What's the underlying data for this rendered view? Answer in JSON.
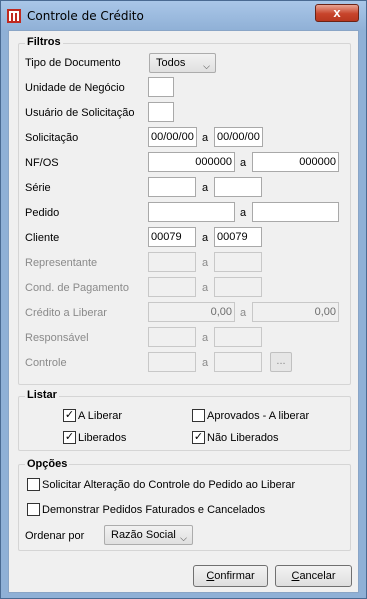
{
  "window": {
    "title": "Controle de Crédito",
    "close_glyph": "x"
  },
  "filtros": {
    "title": "Filtros",
    "tipo_documento": {
      "label": "Tipo de Documento",
      "value": "Todos"
    },
    "unidade_negocio": {
      "label": "Unidade de Negócio",
      "value": ""
    },
    "usuario_solicitacao": {
      "label": "Usuário de Solicitação",
      "value": ""
    },
    "solicitacao": {
      "label": "Solicitação",
      "from": "00/00/00",
      "sep": "a",
      "to": "00/00/00"
    },
    "nf_os": {
      "label": "NF/OS",
      "from": "000000",
      "sep": "a",
      "to": "000000"
    },
    "serie": {
      "label": "Série",
      "from": "",
      "sep": "a",
      "to": ""
    },
    "pedido": {
      "label": "Pedido",
      "from": "",
      "sep": "a",
      "to": ""
    },
    "cliente": {
      "label": "Cliente",
      "from": "00079",
      "sep": "a",
      "to": "00079"
    },
    "representante": {
      "label": "Representante",
      "from": "",
      "sep": "a",
      "to": ""
    },
    "cond_pagamento": {
      "label": "Cond. de Pagamento",
      "from": "",
      "sep": "a",
      "to": ""
    },
    "credito_liberar": {
      "label": "Crédito a Liberar",
      "from": "0,00",
      "sep": "a",
      "to": "0,00"
    },
    "responsavel": {
      "label": "Responsável",
      "from": "",
      "sep": "a",
      "to": ""
    },
    "controle": {
      "label": "Controle",
      "from": "",
      "sep": "a",
      "to": "",
      "button": "..."
    }
  },
  "listar": {
    "title": "Listar",
    "a_liberar": {
      "label": "A Liberar",
      "checked": true
    },
    "aprovados": {
      "label": "Aprovados - A liberar",
      "checked": false
    },
    "liberados": {
      "label": "Liberados",
      "checked": true
    },
    "nao_liberados": {
      "label": "Não Liberados",
      "checked": true
    }
  },
  "opcoes": {
    "title": "Opções",
    "solicitar_alteracao": {
      "label": "Solicitar Alteração do Controle do Pedido ao Liberar",
      "checked": false
    },
    "demonstrar_pedidos": {
      "label": "Demonstrar Pedidos Faturados e Cancelados",
      "checked": false
    },
    "ordenar_por": {
      "label": "Ordenar por",
      "value": "Razão Social"
    }
  },
  "buttons": {
    "confirmar_u": "C",
    "confirmar_rest": "onfirmar",
    "cancelar_u": "C",
    "cancelar_rest": "ancelar"
  }
}
